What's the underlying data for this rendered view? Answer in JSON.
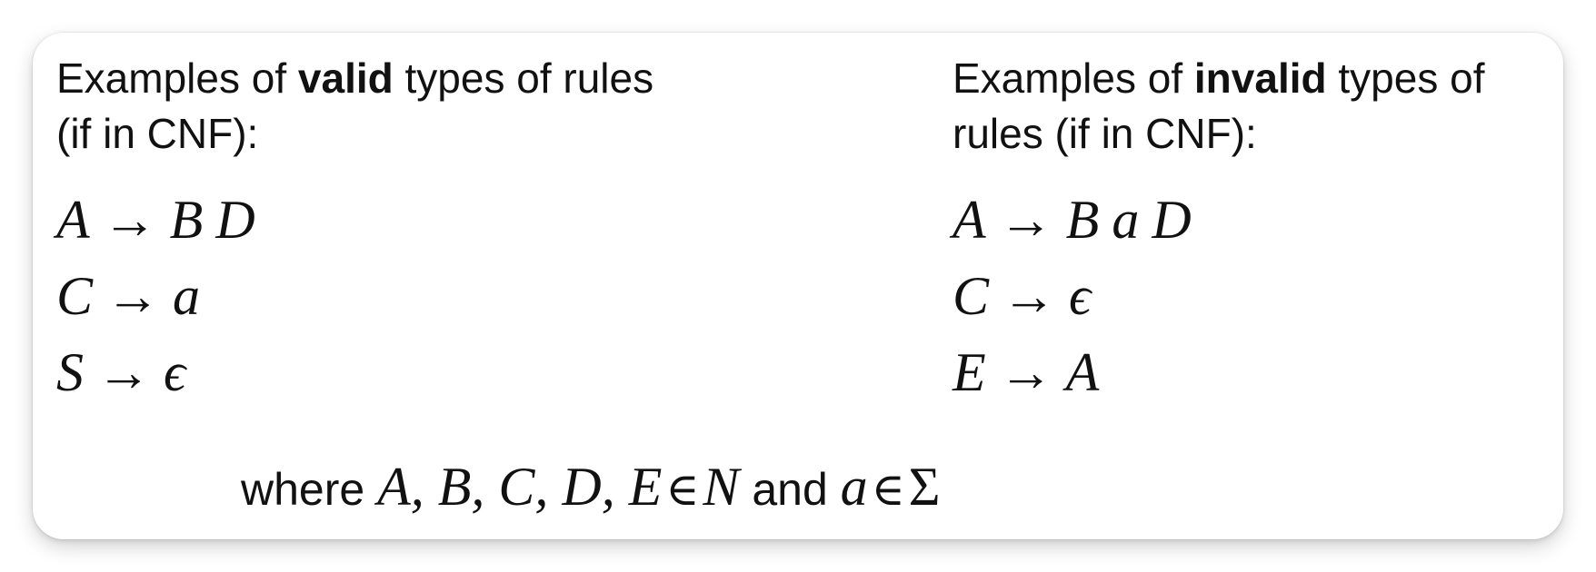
{
  "valid": {
    "heading_prefix": "Examples of ",
    "heading_bold": "valid",
    "heading_suffix_line1": " types of rules",
    "heading_line2": "(if in CNF):",
    "rules": [
      {
        "lhs": "A",
        "arrow": "→",
        "rhs": [
          "B",
          "D"
        ]
      },
      {
        "lhs": "C",
        "arrow": "→",
        "rhs": [
          "a"
        ]
      },
      {
        "lhs": "S",
        "arrow": "→",
        "rhs": [
          "ϵ"
        ]
      }
    ]
  },
  "invalid": {
    "heading_prefix": "Examples of ",
    "heading_bold": "invalid",
    "heading_suffix_line1": " types of",
    "heading_line2": "rules (if in CNF):",
    "rules": [
      {
        "lhs": "A",
        "arrow": "→",
        "rhs": [
          "B",
          "a",
          "D"
        ]
      },
      {
        "lhs": "C",
        "arrow": "→",
        "rhs": [
          "ϵ"
        ]
      },
      {
        "lhs": "E",
        "arrow": "→",
        "rhs": [
          "A"
        ]
      }
    ]
  },
  "footnote": {
    "where": "where ",
    "nonterminals": "A, B, C, D, E",
    "in_symbol": "∈",
    "nonterminal_set": "N",
    "and": " and ",
    "terminal": "a",
    "terminal_set": "Σ"
  }
}
